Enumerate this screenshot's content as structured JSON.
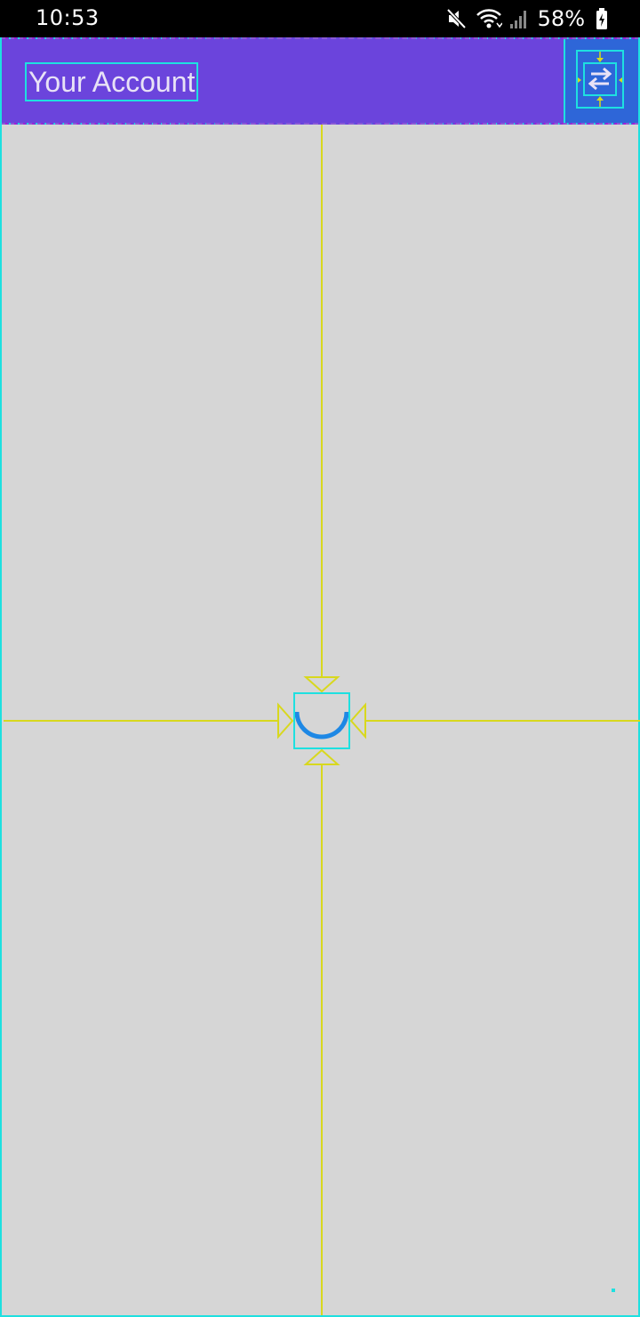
{
  "status_bar": {
    "time": "10:53",
    "battery_percent": "58%",
    "icons": [
      "mute-icon",
      "wifi-icon",
      "signal-icon",
      "battery-charging-icon"
    ]
  },
  "app_bar": {
    "title": "Your Account",
    "action_icon": "swap-arrows-icon",
    "background_color": "#6b44dc",
    "action_background_color": "#2e66d8"
  },
  "content": {
    "state": "loading",
    "spinner_icon": "loading-spinner-icon",
    "spinner_color": "#1e88e5",
    "background_color": "#d6d6d6"
  },
  "colors": {
    "layout_bounds": "#1ee0e0",
    "guides": "#d8d81e",
    "margins": "#d000d0"
  }
}
